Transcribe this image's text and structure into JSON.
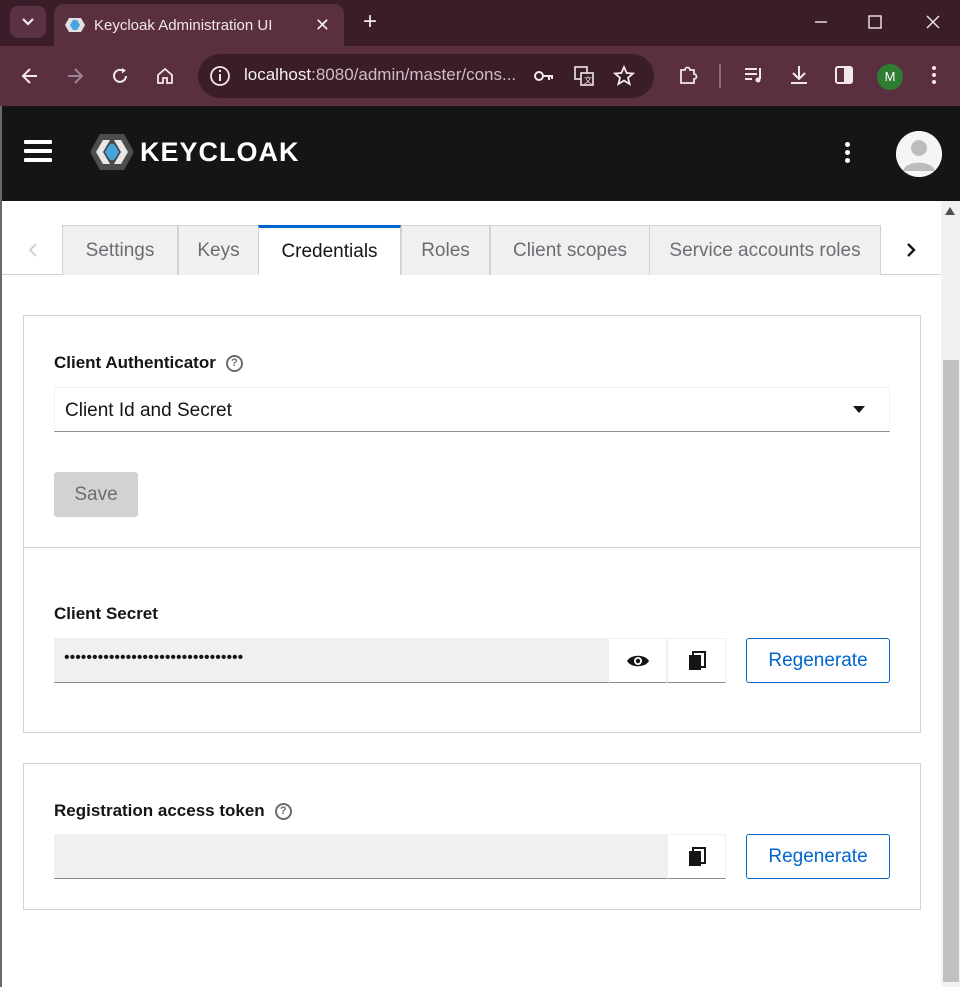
{
  "browser": {
    "tab_title": "Keycloak Administration UI",
    "url_host": "localhost",
    "url_rest": ":8080/admin/master/cons...",
    "profile_initial": "M",
    "icons": [
      "tab-list-icon",
      "close-icon",
      "plus-icon",
      "minimize-icon",
      "maximize-icon",
      "close-window-icon",
      "back-icon",
      "forward-icon",
      "reload-icon",
      "home-icon",
      "site-info-icon",
      "key-icon",
      "translate-icon",
      "star-icon",
      "extensions-icon",
      "media-icon",
      "download-icon",
      "side-panel-icon",
      "more-icon"
    ]
  },
  "header": {
    "logo_text": "KEYCLOAK"
  },
  "tabs": [
    {
      "label": "Settings",
      "active": false
    },
    {
      "label": "Keys",
      "active": false
    },
    {
      "label": "Credentials",
      "active": true
    },
    {
      "label": "Roles",
      "active": false
    },
    {
      "label": "Client scopes",
      "active": false
    },
    {
      "label": "Service accounts roles",
      "active": false
    }
  ],
  "authenticator": {
    "label": "Client Authenticator",
    "selected": "Client Id and Secret",
    "save_label": "Save"
  },
  "secret": {
    "label": "Client Secret",
    "value": "••••••••••••••••••••••••••••••••",
    "regenerate_label": "Regenerate"
  },
  "registration": {
    "label": "Registration access token",
    "value": "",
    "regenerate_label": "Regenerate"
  },
  "colors": {
    "accent": "#0066cc",
    "header_bg": "#151515",
    "browser_frame": "#3b1d2a",
    "browser_toolbar": "#5a2f3f"
  }
}
